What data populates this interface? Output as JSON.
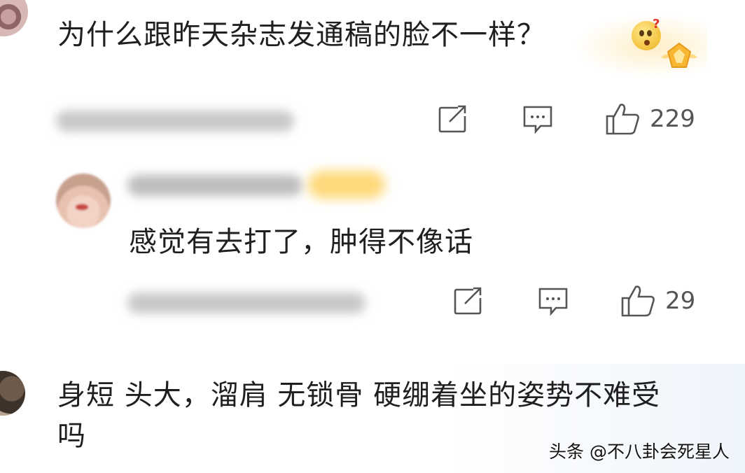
{
  "comments": [
    {
      "text": "为什么跟昨天杂志发通稿的脸不一样？",
      "likes": "229"
    },
    {
      "text": "感觉有去打了，肿得不像话",
      "likes": "29"
    },
    {
      "text": "身短 头大，溜肩 无锁骨 硬绷着坐的姿势不难受吗"
    }
  ],
  "icons": {
    "share": "share-icon",
    "comment": "comment-icon",
    "like": "thumbs-up-icon",
    "emoji": "confused-face-emoji",
    "medal": "vip-medal-icon"
  },
  "watermark": "头条 @不八卦会死星人",
  "colors": {
    "icon": "#555555",
    "text": "#1f1f1f",
    "vip_badge": "#ffd97a"
  }
}
